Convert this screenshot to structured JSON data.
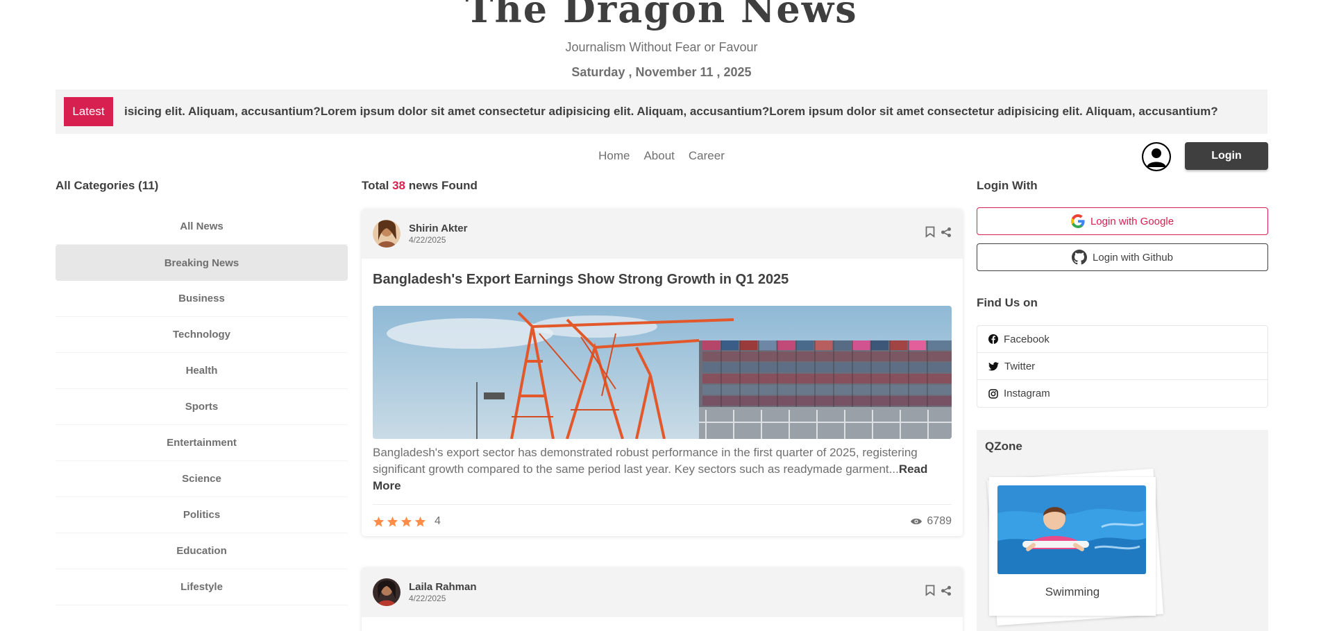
{
  "header": {
    "site_title": "The Dragon News",
    "tagline": "Journalism Without Fear or Favour",
    "date": "Saturday , November 11 , 2025"
  },
  "ticker": {
    "label": "Latest",
    "text": "isicing elit. Aliquam, accusantium?Lorem ipsum dolor sit amet consectetur adipisicing elit. Aliquam, accusantium?Lorem ipsum dolor sit amet consectetur adipisicing elit. Aliquam, accusantium?"
  },
  "nav": {
    "items": [
      "Home",
      "About",
      "Career"
    ],
    "login_label": "Login"
  },
  "categories": {
    "heading": "All Categories (11)",
    "items": [
      "All News",
      "Breaking News",
      "Business",
      "Technology",
      "Health",
      "Sports",
      "Entertainment",
      "Science",
      "Politics",
      "Education",
      "Lifestyle"
    ],
    "active": "Breaking News"
  },
  "news": {
    "total_prefix": "Total",
    "total_count": "38",
    "total_suffix": "news Found",
    "cards": [
      {
        "author": "Shirin Akter",
        "date": "4/22/2025",
        "title": "Bangladesh's Export Earnings Show Strong Growth in Q1 2025",
        "excerpt": "Bangladesh's export sector has demonstrated robust performance in the first quarter of 2025, registering significant growth compared to the same period last year. Key sectors such as readymade garment...",
        "read_more": "Read More",
        "rating": "4",
        "rating_value": 4,
        "views": "6789"
      },
      {
        "author": "Laila Rahman",
        "date": "4/22/2025"
      }
    ]
  },
  "right": {
    "login_with": "Login With",
    "google_label": "Login with Google",
    "github_label": "Login with Github",
    "find_us": "Find Us on",
    "social": [
      "Facebook",
      "Twitter",
      "Instagram"
    ],
    "qzone_title": "QZone",
    "qzone_caption": "Swimming"
  },
  "colors": {
    "accent": "#d72050",
    "dark": "#403f3f",
    "muted": "#706f6f",
    "panel": "#f3f3f3",
    "star": "#ff8c47"
  }
}
